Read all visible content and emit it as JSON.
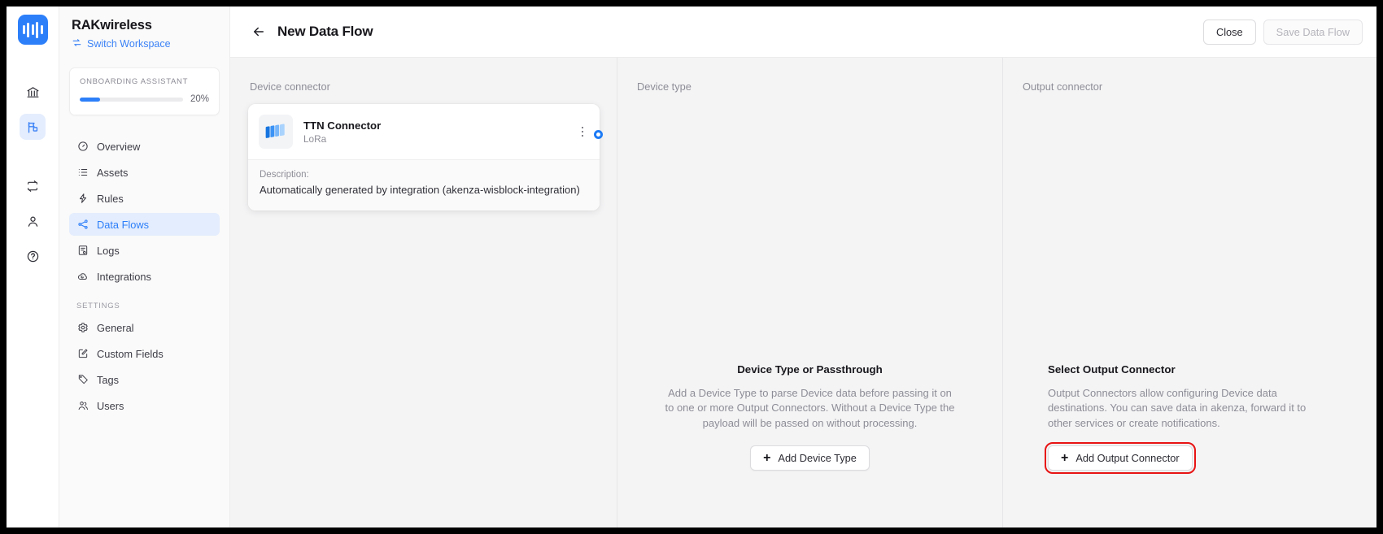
{
  "rail": {
    "logo_name": "akenza-logo",
    "items": [
      {
        "name": "bank-icon",
        "label": "Organization",
        "active": false
      },
      {
        "name": "flag-icon",
        "label": "Workspace",
        "active": true
      },
      {
        "name": "repeat-icon",
        "label": "Transfer",
        "active": false
      },
      {
        "name": "user-icon",
        "label": "Account",
        "active": false
      },
      {
        "name": "help-icon",
        "label": "Help",
        "active": false
      }
    ]
  },
  "sidebar": {
    "brand": "RAKwireless",
    "switch_workspace": "Switch Workspace",
    "switch_icon": "switch-icon",
    "onboarding": {
      "label": "ONBOARDING ASSISTANT",
      "percent_label": "20%",
      "percent_value": 20
    },
    "nav": [
      {
        "label": "Overview",
        "icon": "gauge-icon",
        "active": false
      },
      {
        "label": "Assets",
        "icon": "list-icon",
        "active": false
      },
      {
        "label": "Rules",
        "icon": "bolt-icon",
        "active": false
      },
      {
        "label": "Data Flows",
        "icon": "share-icon",
        "active": true
      },
      {
        "label": "Logs",
        "icon": "logs-icon",
        "active": false
      },
      {
        "label": "Integrations",
        "icon": "cloud-icon",
        "active": false
      }
    ],
    "settings_label": "SETTINGS",
    "settings": [
      {
        "label": "General",
        "icon": "gear-icon",
        "active": false
      },
      {
        "label": "Custom Fields",
        "icon": "edit-box-icon",
        "active": false
      },
      {
        "label": "Tags",
        "icon": "tag-icon",
        "active": false
      },
      {
        "label": "Users",
        "icon": "users-icon",
        "active": false
      }
    ]
  },
  "topbar": {
    "back_icon": "arrow-left-icon",
    "title": "New Data Flow",
    "close_label": "Close",
    "save_label": "Save Data Flow",
    "save_disabled": true
  },
  "canvas": {
    "device_connector": {
      "column_label": "Device connector",
      "card": {
        "title": "TTN Connector",
        "subtitle": "LoRa",
        "logo_icon": "ttn-connector-icon",
        "menu_icon": "kebab-menu-icon",
        "description_label": "Description:",
        "description_value": "Automatically generated by integration (akenza-wisblock-integration)"
      }
    },
    "device_type": {
      "column_label": "Device type",
      "title": "Device Type or Passthrough",
      "text": "Add a Device Type to parse Device data before passing it on to one or more Output Connectors. Without a Device Type the payload will be passed on without processing.",
      "button_label": "Add Device Type",
      "button_icon": "plus-icon"
    },
    "output_connector": {
      "column_label": "Output connector",
      "title": "Select Output Connector",
      "text": "Output Connectors allow configuring Device data destinations. You can save data in akenza, forward it to other services or create notifications.",
      "button_label": "Add Output Connector",
      "button_icon": "plus-icon",
      "button_highlighted": true
    }
  },
  "colors": {
    "accent": "#2d7ff9",
    "accent_soft": "#e4edfd",
    "canvas_bg": "#f4f4f5",
    "highlight": "#e81313",
    "text": "#17171c",
    "muted": "#8d8d97"
  }
}
